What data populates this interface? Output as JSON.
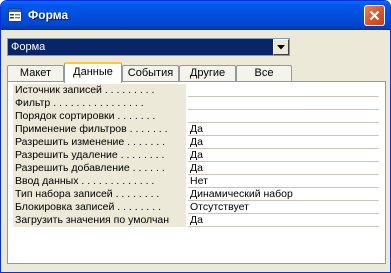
{
  "window": {
    "title": "Форма",
    "app_icon": "form-properties-icon",
    "close_icon": "close-icon",
    "accent": "#0050dc"
  },
  "selector": {
    "selected": "Форма",
    "dropdown_icon": "chevron-down-icon"
  },
  "tabs": [
    {
      "label": "Макет",
      "active": false
    },
    {
      "label": "Данные",
      "active": true
    },
    {
      "label": "События",
      "active": false
    },
    {
      "label": "Другие",
      "active": false
    },
    {
      "label": "Все",
      "active": false
    }
  ],
  "properties": [
    {
      "label": "Источник записей . . . . . . . . .",
      "value": ""
    },
    {
      "label": "Фильтр . . . . . . . . . . . . . . . .",
      "value": ""
    },
    {
      "label": "Порядок сортировки . . . . . . .",
      "value": ""
    },
    {
      "label": "Применение фильтров . . . . . . .",
      "value": "Да"
    },
    {
      "label": "Разрешить изменение . . . . . . .",
      "value": "Да"
    },
    {
      "label": "Разрешить удаление . . . . . . . .",
      "value": "Да"
    },
    {
      "label": "Разрешить добавление . . . . . .",
      "value": "Да"
    },
    {
      "label": "Ввод данных . . . . . . . . . . . . .",
      "value": "Нет"
    },
    {
      "label": "Тип набора записей . . . . . . . .",
      "value": "Динамический набор"
    },
    {
      "label": "Блокировка записей . . . . . . . .",
      "value": "Отсутствует"
    },
    {
      "label": "Загрузить значения по умолчан",
      "value": "Да"
    }
  ]
}
